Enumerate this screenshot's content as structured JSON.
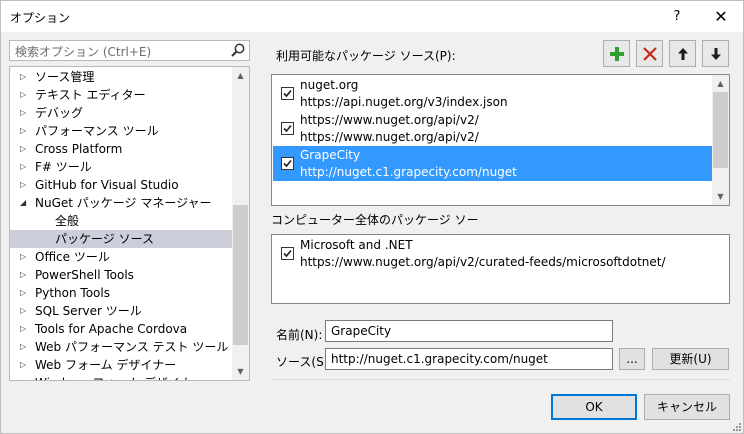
{
  "window": {
    "title": "オプション",
    "help": "?",
    "close": "✕"
  },
  "search": {
    "placeholder": "検索オプション (Ctrl+E)"
  },
  "tree": {
    "items": [
      {
        "label": "ソース管理",
        "expanded": false
      },
      {
        "label": "テキスト エディター",
        "expanded": false
      },
      {
        "label": "デバッグ",
        "expanded": false
      },
      {
        "label": "パフォーマンス ツール",
        "expanded": false
      },
      {
        "label": "Cross Platform",
        "expanded": false
      },
      {
        "label": "F# ツール",
        "expanded": false
      },
      {
        "label": "GitHub for Visual Studio",
        "expanded": false
      },
      {
        "label": "NuGet パッケージ マネージャー",
        "expanded": true
      },
      {
        "label": "全般",
        "child": true
      },
      {
        "label": "パッケージ ソース",
        "child": true,
        "selected": true
      },
      {
        "label": "Office ツール",
        "expanded": false
      },
      {
        "label": "PowerShell Tools",
        "expanded": false
      },
      {
        "label": "Python Tools",
        "expanded": false
      },
      {
        "label": "SQL Server ツール",
        "expanded": false
      },
      {
        "label": "Tools for Apache Cordova",
        "expanded": false
      },
      {
        "label": "Web パフォーマンス テスト ツール",
        "expanded": false
      },
      {
        "label": "Web フォーム デザイナー",
        "expanded": false
      },
      {
        "label": "Windows フォーム デザイナー",
        "expanded": false
      }
    ]
  },
  "sources": {
    "label": "利用可能なパッケージ ソース(P):",
    "toolbar": {
      "add": "add-icon",
      "remove": "remove-icon",
      "up": "arrow-up-icon",
      "down": "arrow-down-icon"
    },
    "items": [
      {
        "name": "nuget.org",
        "url": "https://api.nuget.org/v3/index.json",
        "checked": true,
        "selected": false
      },
      {
        "name": "https://www.nuget.org/api/v2/",
        "url": "https://www.nuget.org/api/v2/",
        "checked": true,
        "selected": false
      },
      {
        "name": "GrapeCity",
        "url": "http://nuget.c1.grapecity.com/nuget",
        "checked": true,
        "selected": true
      }
    ]
  },
  "machine_sources": {
    "label": "コンピューター全体のパッケージ ソー",
    "items": [
      {
        "name": "Microsoft and .NET",
        "url": "https://www.nuget.org/api/v2/curated-feeds/microsoftdotnet/",
        "checked": true
      }
    ]
  },
  "form": {
    "name_label": "名前(N):",
    "name_value": "GrapeCity",
    "source_label": "ソース(S):",
    "source_value": "http://nuget.c1.grapecity.com/nuget",
    "browse_label": "...",
    "update_label": "更新(U)"
  },
  "buttons": {
    "ok": "OK",
    "cancel": "キャンセル"
  },
  "colors": {
    "selection": "#3399ff",
    "tree_selection": "#cccedb",
    "add": "#2e9e2e",
    "remove": "#c42b1c",
    "focus_border": "#0078d7"
  }
}
